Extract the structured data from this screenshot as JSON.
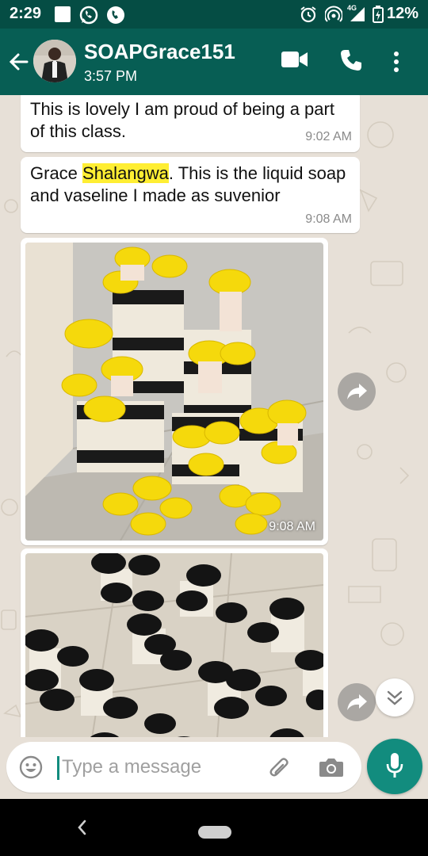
{
  "status_bar": {
    "time": "2:29",
    "network": "4G",
    "battery": "12%"
  },
  "header": {
    "contact_name": "SOAPGrace151",
    "last_seen": "3:57 PM"
  },
  "messages": [
    {
      "text": "This is lovely I am proud of being a part of this class.",
      "time": "9:02 AM"
    },
    {
      "text_highlight": "Shalangwa",
      "text_before": "Grace ",
      "text_after": ". This is the liquid soap and vaseline I made as suvenior",
      "time": "9:08 AM"
    },
    {
      "type": "image",
      "image_icon": "yellow-lid-jars-photo",
      "time": "9:08 AM"
    },
    {
      "type": "image",
      "image_icon": "black-lid-jars-photo",
      "time": ""
    }
  ],
  "input": {
    "placeholder": "Type a message"
  },
  "colors": {
    "header": "#075e54",
    "status_bar": "#054d44",
    "accent": "#128c7e",
    "highlight": "#ffee33"
  }
}
